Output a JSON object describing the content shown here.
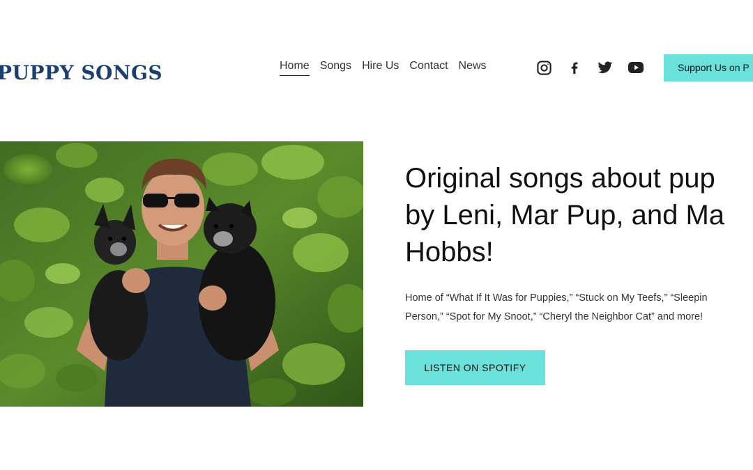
{
  "header": {
    "logo_text": "PUPPY SONGS",
    "nav": [
      {
        "label": "Home",
        "active": true
      },
      {
        "label": "Songs"
      },
      {
        "label": "Hire Us"
      },
      {
        "label": "Contact"
      },
      {
        "label": "News"
      }
    ],
    "social_icons": [
      "instagram-icon",
      "facebook-icon",
      "twitter-icon",
      "youtube-icon"
    ],
    "support_button": "Support Us on P"
  },
  "hero": {
    "title": "Original songs about pup\nby Leni, Mar Pup, and Ma\nHobbs!",
    "description": "Home of “What If It Was for Puppies,” “Stuck on My Teefs,” “Sleepin\nPerson,” “Spot for My Snoot,” “Cheryl the Neighbor Cat” and more!",
    "spotify_button": "LISTEN ON SPOTIFY"
  },
  "colors": {
    "accent": "#6be1dc",
    "logo": "#1c3f6e",
    "text": "#111111"
  }
}
